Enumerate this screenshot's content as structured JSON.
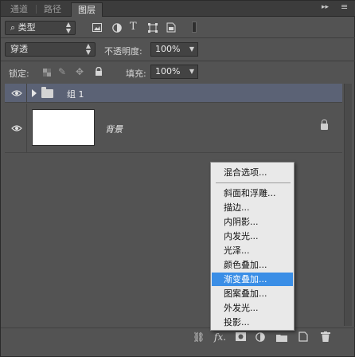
{
  "tabs": [
    {
      "label": "通道"
    },
    {
      "label": "路径"
    },
    {
      "label": "图层"
    }
  ],
  "tab_controls": {
    "collapse": "▸▸",
    "menu": "≡"
  },
  "filter": {
    "selected": "类型",
    "search_glyph": "⌕"
  },
  "filter_icons": [
    "image-filter-icon",
    "adjustment-filter-icon",
    "text-filter-icon",
    "shape-filter-icon",
    "smart-object-filter-icon"
  ],
  "blend": {
    "mode": "穿透",
    "opacity_label": "不透明度:",
    "opacity_value": "100%"
  },
  "lock": {
    "label": "锁定:",
    "fill_label": "填充:",
    "fill_value": "100%"
  },
  "layers": [
    {
      "name": "组 1",
      "type": "group",
      "selected": true
    },
    {
      "name": "背景",
      "type": "background",
      "locked": true
    }
  ],
  "context_menu": {
    "items": [
      {
        "label": "混合选项..."
      },
      {
        "label": "斜面和浮雕..."
      },
      {
        "label": "描边..."
      },
      {
        "label": "内阴影..."
      },
      {
        "label": "内发光..."
      },
      {
        "label": "光泽..."
      },
      {
        "label": "颜色叠加..."
      },
      {
        "label": "渐变叠加...",
        "highlighted": true
      },
      {
        "label": "图案叠加..."
      },
      {
        "label": "外发光..."
      },
      {
        "label": "投影..."
      }
    ]
  },
  "bottom_toolbar": {
    "fx_label": "fx."
  },
  "colors": {
    "panel_bg": "#535353",
    "selected_row": "#5b6275",
    "menu_bg": "#e9e9e9",
    "menu_highlight": "#3a8ee6"
  }
}
